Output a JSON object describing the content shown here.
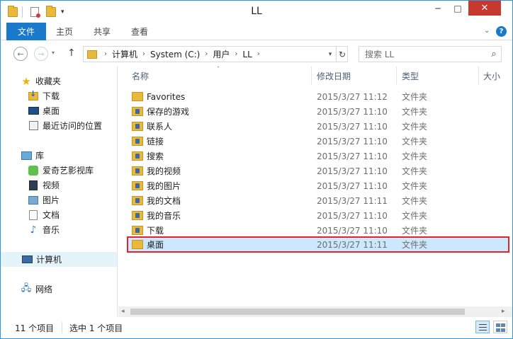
{
  "window": {
    "title": "LL"
  },
  "titlebar": {
    "minimize": "─",
    "maximize": "□",
    "close": "✕",
    "dropdown": "▾"
  },
  "ribbon": {
    "tabs": [
      {
        "label": "文件"
      },
      {
        "label": "主页"
      },
      {
        "label": "共享"
      },
      {
        "label": "查看"
      }
    ],
    "expand_glyph": "⌄",
    "help_glyph": "?"
  },
  "nav": {
    "back_glyph": "←",
    "forward_glyph": "→",
    "recent_glyph": "▾",
    "up_glyph": "↑",
    "breadcrumb": [
      "计算机",
      "System (C:)",
      "用户",
      "LL"
    ],
    "sep_glyph": "›",
    "dropdown_glyph": "▾",
    "refresh_glyph": "↻"
  },
  "search": {
    "placeholder": "搜索 LL",
    "icon": "⌕"
  },
  "sidebar": {
    "favorites": {
      "label": "收藏夹",
      "items": [
        "下载",
        "桌面",
        "最近访问的位置"
      ]
    },
    "libraries": {
      "label": "库",
      "items": [
        "爱奇艺影视库",
        "视频",
        "图片",
        "文档",
        "音乐"
      ]
    },
    "computer": {
      "label": "计算机"
    },
    "network": {
      "label": "网络"
    }
  },
  "columns": {
    "name": "名称",
    "date": "修改日期",
    "type": "类型",
    "size": "大小",
    "sort_glyph": "˄"
  },
  "files": [
    {
      "name": "Favorites",
      "date": "2015/3/27 11:12",
      "type": "文件夹"
    },
    {
      "name": "保存的游戏",
      "date": "2015/3/27 11:10",
      "type": "文件夹"
    },
    {
      "name": "联系人",
      "date": "2015/3/27 11:10",
      "type": "文件夹"
    },
    {
      "name": "链接",
      "date": "2015/3/27 11:10",
      "type": "文件夹"
    },
    {
      "name": "搜索",
      "date": "2015/3/27 11:10",
      "type": "文件夹"
    },
    {
      "name": "我的视频",
      "date": "2015/3/27 11:10",
      "type": "文件夹"
    },
    {
      "name": "我的图片",
      "date": "2015/3/27 11:10",
      "type": "文件夹"
    },
    {
      "name": "我的文档",
      "date": "2015/3/27 11:11",
      "type": "文件夹"
    },
    {
      "name": "我的音乐",
      "date": "2015/3/27 11:10",
      "type": "文件夹"
    },
    {
      "name": "下载",
      "date": "2015/3/27 11:10",
      "type": "文件夹"
    },
    {
      "name": "桌面",
      "date": "2015/3/27 11:11",
      "type": "文件夹",
      "selected": true
    }
  ],
  "scroll": {
    "left": "◂",
    "right": "▸"
  },
  "status": {
    "count": "11 个项目",
    "selection": "选中 1 个项目"
  },
  "colors": {
    "accent": "#1979ca",
    "selection": "#cce8ff",
    "highlight_border": "#e0242b",
    "close": "#c7392f"
  }
}
